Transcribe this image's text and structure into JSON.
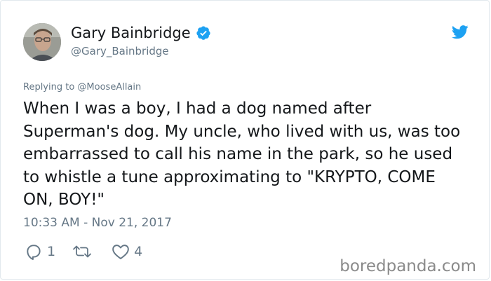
{
  "tweet": {
    "display_name": "Gary Bainbridge",
    "handle": "@Gary_Bainbridge",
    "replying_to": "Replying to @MooseAllain",
    "text": "When I was a boy, I had a dog named after Superman's dog. My uncle, who lived with us, was too embarrassed to call his name in the park, so he used to whistle a tune approximating to \"KRYPTO, COME ON, BOY!\"",
    "timestamp": "10:33 AM - Nov 21, 2017"
  },
  "actions": {
    "reply_count": "1",
    "retweet_count": "",
    "like_count": "4"
  },
  "watermark": "boredpanda.com",
  "colors": {
    "text_primary": "#14171a",
    "text_secondary": "#657786",
    "verified_blue": "#1da1f2",
    "twitter_blue": "#1da1f2",
    "border": "#e1e8ed"
  },
  "icons": {
    "verified": "verified-badge-icon",
    "brand": "twitter-bird-icon",
    "reply": "reply-bubble-icon",
    "retweet": "retweet-icon",
    "like": "heart-icon"
  }
}
